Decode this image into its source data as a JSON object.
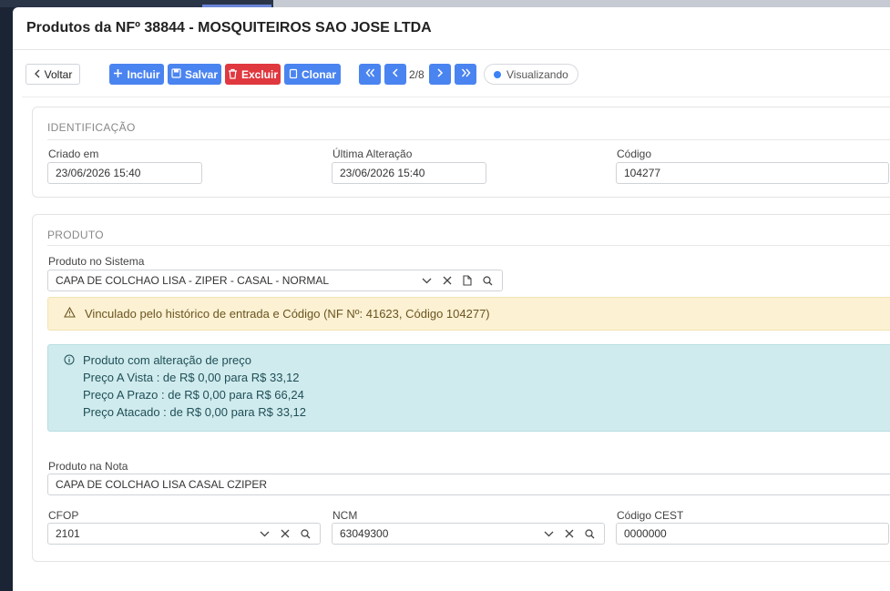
{
  "modal": {
    "title": "Produtos da NFº 38844 - MOSQUITEIROS SAO JOSE LTDA"
  },
  "toolbar": {
    "back_label": "Voltar",
    "add_label": "Incluir",
    "save_label": "Salvar",
    "delete_label": "Excluir",
    "clone_label": "Clonar",
    "page_indicator": "2/8",
    "status_label": "Visualizando"
  },
  "identificacao": {
    "title": "IDENTIFICAÇÃO",
    "created_label": "Criado em",
    "created_value": "23/06/2026 15:40",
    "updated_label": "Última Alteração",
    "updated_value": "23/06/2026 15:40",
    "code_label": "Código",
    "code_value": "104277"
  },
  "produto": {
    "title": "PRODUTO",
    "system_label": "Produto no Sistema",
    "system_value": "CAPA DE COLCHAO LISA - ZIPER - CASAL - NORMAL",
    "warning_text": "Vinculado pelo histórico de entrada e Código (NF Nº: 41623, Código 104277)",
    "info_title": "Produto com alteração de preço",
    "info_lines": [
      "Preço A Vista : de R$ 0,00 para R$ 33,12",
      "Preço A Prazo : de R$ 0,00 para R$ 66,24",
      "Preço Atacado : de R$ 0,00 para R$ 33,12"
    ],
    "nota_label": "Produto na Nota",
    "nota_value": "CAPA DE COLCHAO LISA CASAL CZIPER",
    "cfop_label": "CFOP",
    "cfop_value": "2101",
    "ncm_label": "NCM",
    "ncm_value": "63049300",
    "cest_label": "Código CEST",
    "cest_value": "0000000"
  },
  "colors": {
    "primary": "#4a84f0",
    "danger": "#e0383f",
    "warning_bg": "#fcf1d3",
    "info_bg": "#d0ebee"
  }
}
